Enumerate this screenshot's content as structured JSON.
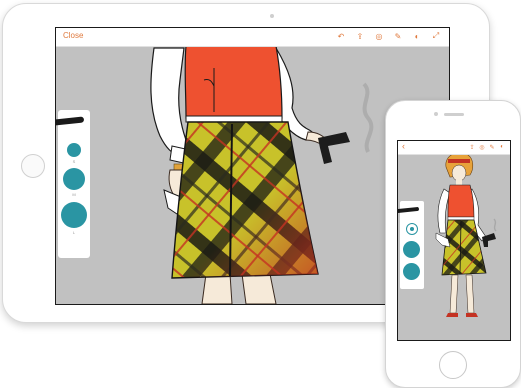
{
  "tablet": {
    "toolbar": {
      "close_label": "Close",
      "icons": [
        "undo-icon",
        "share-icon",
        "layers-icon",
        "brush-icon",
        "color-icon",
        "fullscreen-icon"
      ]
    },
    "brush_panel": {
      "sizes": [
        "S",
        "M",
        "L"
      ]
    }
  },
  "phone": {
    "toolbar": {
      "back_label": "‹",
      "icons": [
        "share-icon",
        "layers-icon",
        "brush-icon",
        "color-icon"
      ]
    }
  },
  "colors": {
    "accent": "#e07a3e",
    "brush_teal": "#2a95a3",
    "canvas_gray": "#c1c1c1",
    "vest_red": "#ee5130",
    "plaid_yellow": "#c8c22a",
    "plaid_red": "#c43222",
    "ink_black": "#141414"
  }
}
